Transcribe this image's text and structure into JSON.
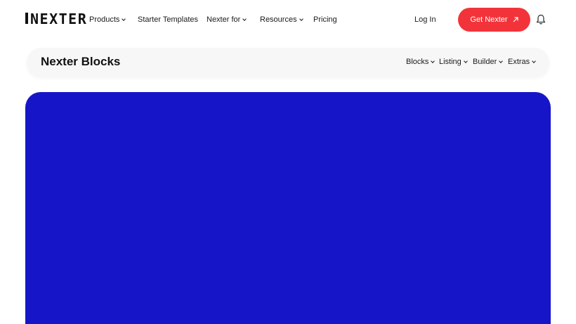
{
  "header": {
    "logo_text": "NEXTER",
    "nav": [
      {
        "label": "Products",
        "dropdown": true
      },
      {
        "label": "Starter Templates",
        "dropdown": false
      },
      {
        "label": "Nexter for",
        "dropdown": true
      },
      {
        "label": "Resources",
        "dropdown": true
      },
      {
        "label": "Pricing",
        "dropdown": false
      }
    ],
    "login_label": "Log In",
    "cta_label": "Get Nexter",
    "cta_icon": "arrow-up-right-icon",
    "bell_icon": "bell-icon"
  },
  "subheader": {
    "title": "Nexter Blocks",
    "nav": [
      {
        "label": "Blocks"
      },
      {
        "label": "Listing"
      },
      {
        "label": "Builder"
      },
      {
        "label": "Extras"
      }
    ]
  },
  "colors": {
    "accent": "#f2343a",
    "hero": "#1616c8"
  }
}
